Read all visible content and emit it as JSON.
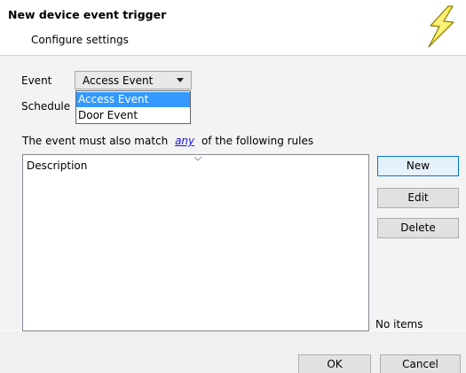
{
  "header": {
    "title": "New device event trigger",
    "subtitle": "Configure settings",
    "icon": "lightning-bolt-icon"
  },
  "form": {
    "event_label": "Event",
    "event_value": "Access Event",
    "schedule_label": "Schedule",
    "event_options": [
      "Access Event",
      "Door Event"
    ],
    "selected_option": "Access Event"
  },
  "rules": {
    "prefix": "The event must also match",
    "match_mode": "any",
    "suffix": "of the following rules",
    "column_header": "Description",
    "status": "No items"
  },
  "buttons": {
    "new": "New",
    "edit": "Edit",
    "delete": "Delete",
    "ok": "OK",
    "cancel": "Cancel"
  },
  "colors": {
    "selection": "#3399ff",
    "link": "#1a1adf",
    "bolt_fill": "#f6e94a"
  }
}
